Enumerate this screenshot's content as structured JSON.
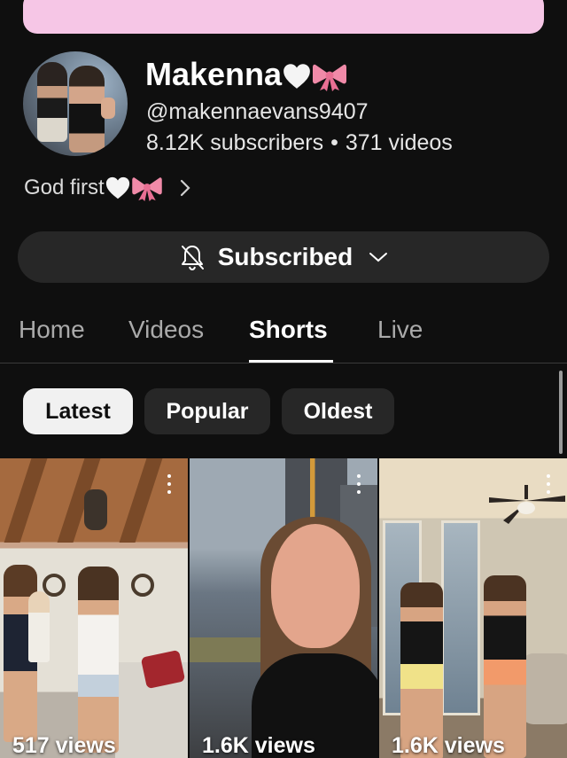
{
  "channel": {
    "name": "Makenna",
    "name_emojis": [
      "white-heart",
      "pink-ribbon"
    ],
    "handle": "@makennaevans9407",
    "subscribers": "8.12K subscribers",
    "separator": "•",
    "videos": "371 videos",
    "bio": "God first",
    "bio_emojis": [
      "white-heart",
      "pink-ribbon"
    ]
  },
  "subscribe_button": {
    "label": "Subscribed",
    "icon": "bell-off-icon",
    "dropdown_icon": "chevron-down-icon"
  },
  "tabs": [
    {
      "label": "Home",
      "active": false
    },
    {
      "label": "Videos",
      "active": false
    },
    {
      "label": "Shorts",
      "active": true
    },
    {
      "label": "Live",
      "active": false
    }
  ],
  "filters": [
    {
      "label": "Latest",
      "selected": true
    },
    {
      "label": "Popular",
      "selected": false
    },
    {
      "label": "Oldest",
      "selected": false
    }
  ],
  "shorts": [
    {
      "views": "517 views"
    },
    {
      "views": "1.6K views"
    },
    {
      "views": "1.6K views"
    }
  ],
  "colors": {
    "background": "#0f0f0f",
    "banner": "#f6c6e6",
    "surface": "#272727",
    "selected_chip": "#f1f1f1",
    "bow": "#f08aa8"
  }
}
